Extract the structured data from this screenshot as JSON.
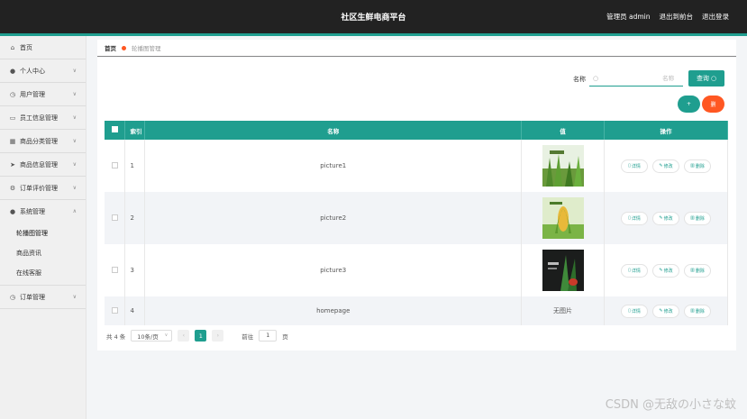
{
  "header": {
    "title": "社区生鲜电商平台",
    "user_label": "管理员 admin",
    "back_label": "退出到前台",
    "logout_label": "退出登录"
  },
  "sidebar": {
    "items": [
      {
        "label": "首页",
        "icon": "home-icon",
        "chevron": false
      },
      {
        "label": "个人中心",
        "icon": "user-icon",
        "chevron": true
      },
      {
        "label": "用户管理",
        "icon": "clock-icon",
        "chevron": true
      },
      {
        "label": "员工信息管理",
        "icon": "monitor-icon",
        "chevron": true
      },
      {
        "label": "商品分类管理",
        "icon": "grid-icon",
        "chevron": true
      },
      {
        "label": "商品信息管理",
        "icon": "send-icon",
        "chevron": true
      },
      {
        "label": "订单评价管理",
        "icon": "gear-icon",
        "chevron": true
      },
      {
        "label": "系统管理",
        "icon": "location-icon",
        "chevron": true,
        "expanded": true
      },
      {
        "label": "订单管理",
        "icon": "clock-icon",
        "chevron": true
      }
    ],
    "sub_items": [
      "轮播图管理",
      "商品资讯",
      "在线客服"
    ]
  },
  "breadcrumb": {
    "home": "首页",
    "current": "轮播图管理"
  },
  "search": {
    "label": "名称",
    "placeholder": "名称",
    "button": "查询"
  },
  "actions": {
    "add": "+",
    "delete": "删"
  },
  "table": {
    "headers": {
      "index": "索引",
      "name": "名称",
      "value": "值",
      "ops": "操作"
    },
    "rows": [
      {
        "index": "1",
        "name": "picture1",
        "value": "image",
        "thumb": "green"
      },
      {
        "index": "2",
        "name": "picture2",
        "value": "image",
        "thumb": "corn"
      },
      {
        "index": "3",
        "name": "picture3",
        "value": "image",
        "thumb": "dark"
      },
      {
        "index": "4",
        "name": "homepage",
        "value": "无图片",
        "thumb": "none"
      }
    ],
    "op_labels": {
      "detail": "详情",
      "edit": "修改",
      "remove": "删除"
    }
  },
  "pager": {
    "total": "共 4 条",
    "page_size": "10条/页",
    "current_page": "1",
    "goto_label": "前往",
    "goto_value": "1",
    "page_suffix": "页"
  },
  "watermark": "CSDN @无敌の小さな蚊",
  "colors": {
    "accent": "#1f9e8f",
    "danger": "#ff5722",
    "topbar": "#222222"
  }
}
